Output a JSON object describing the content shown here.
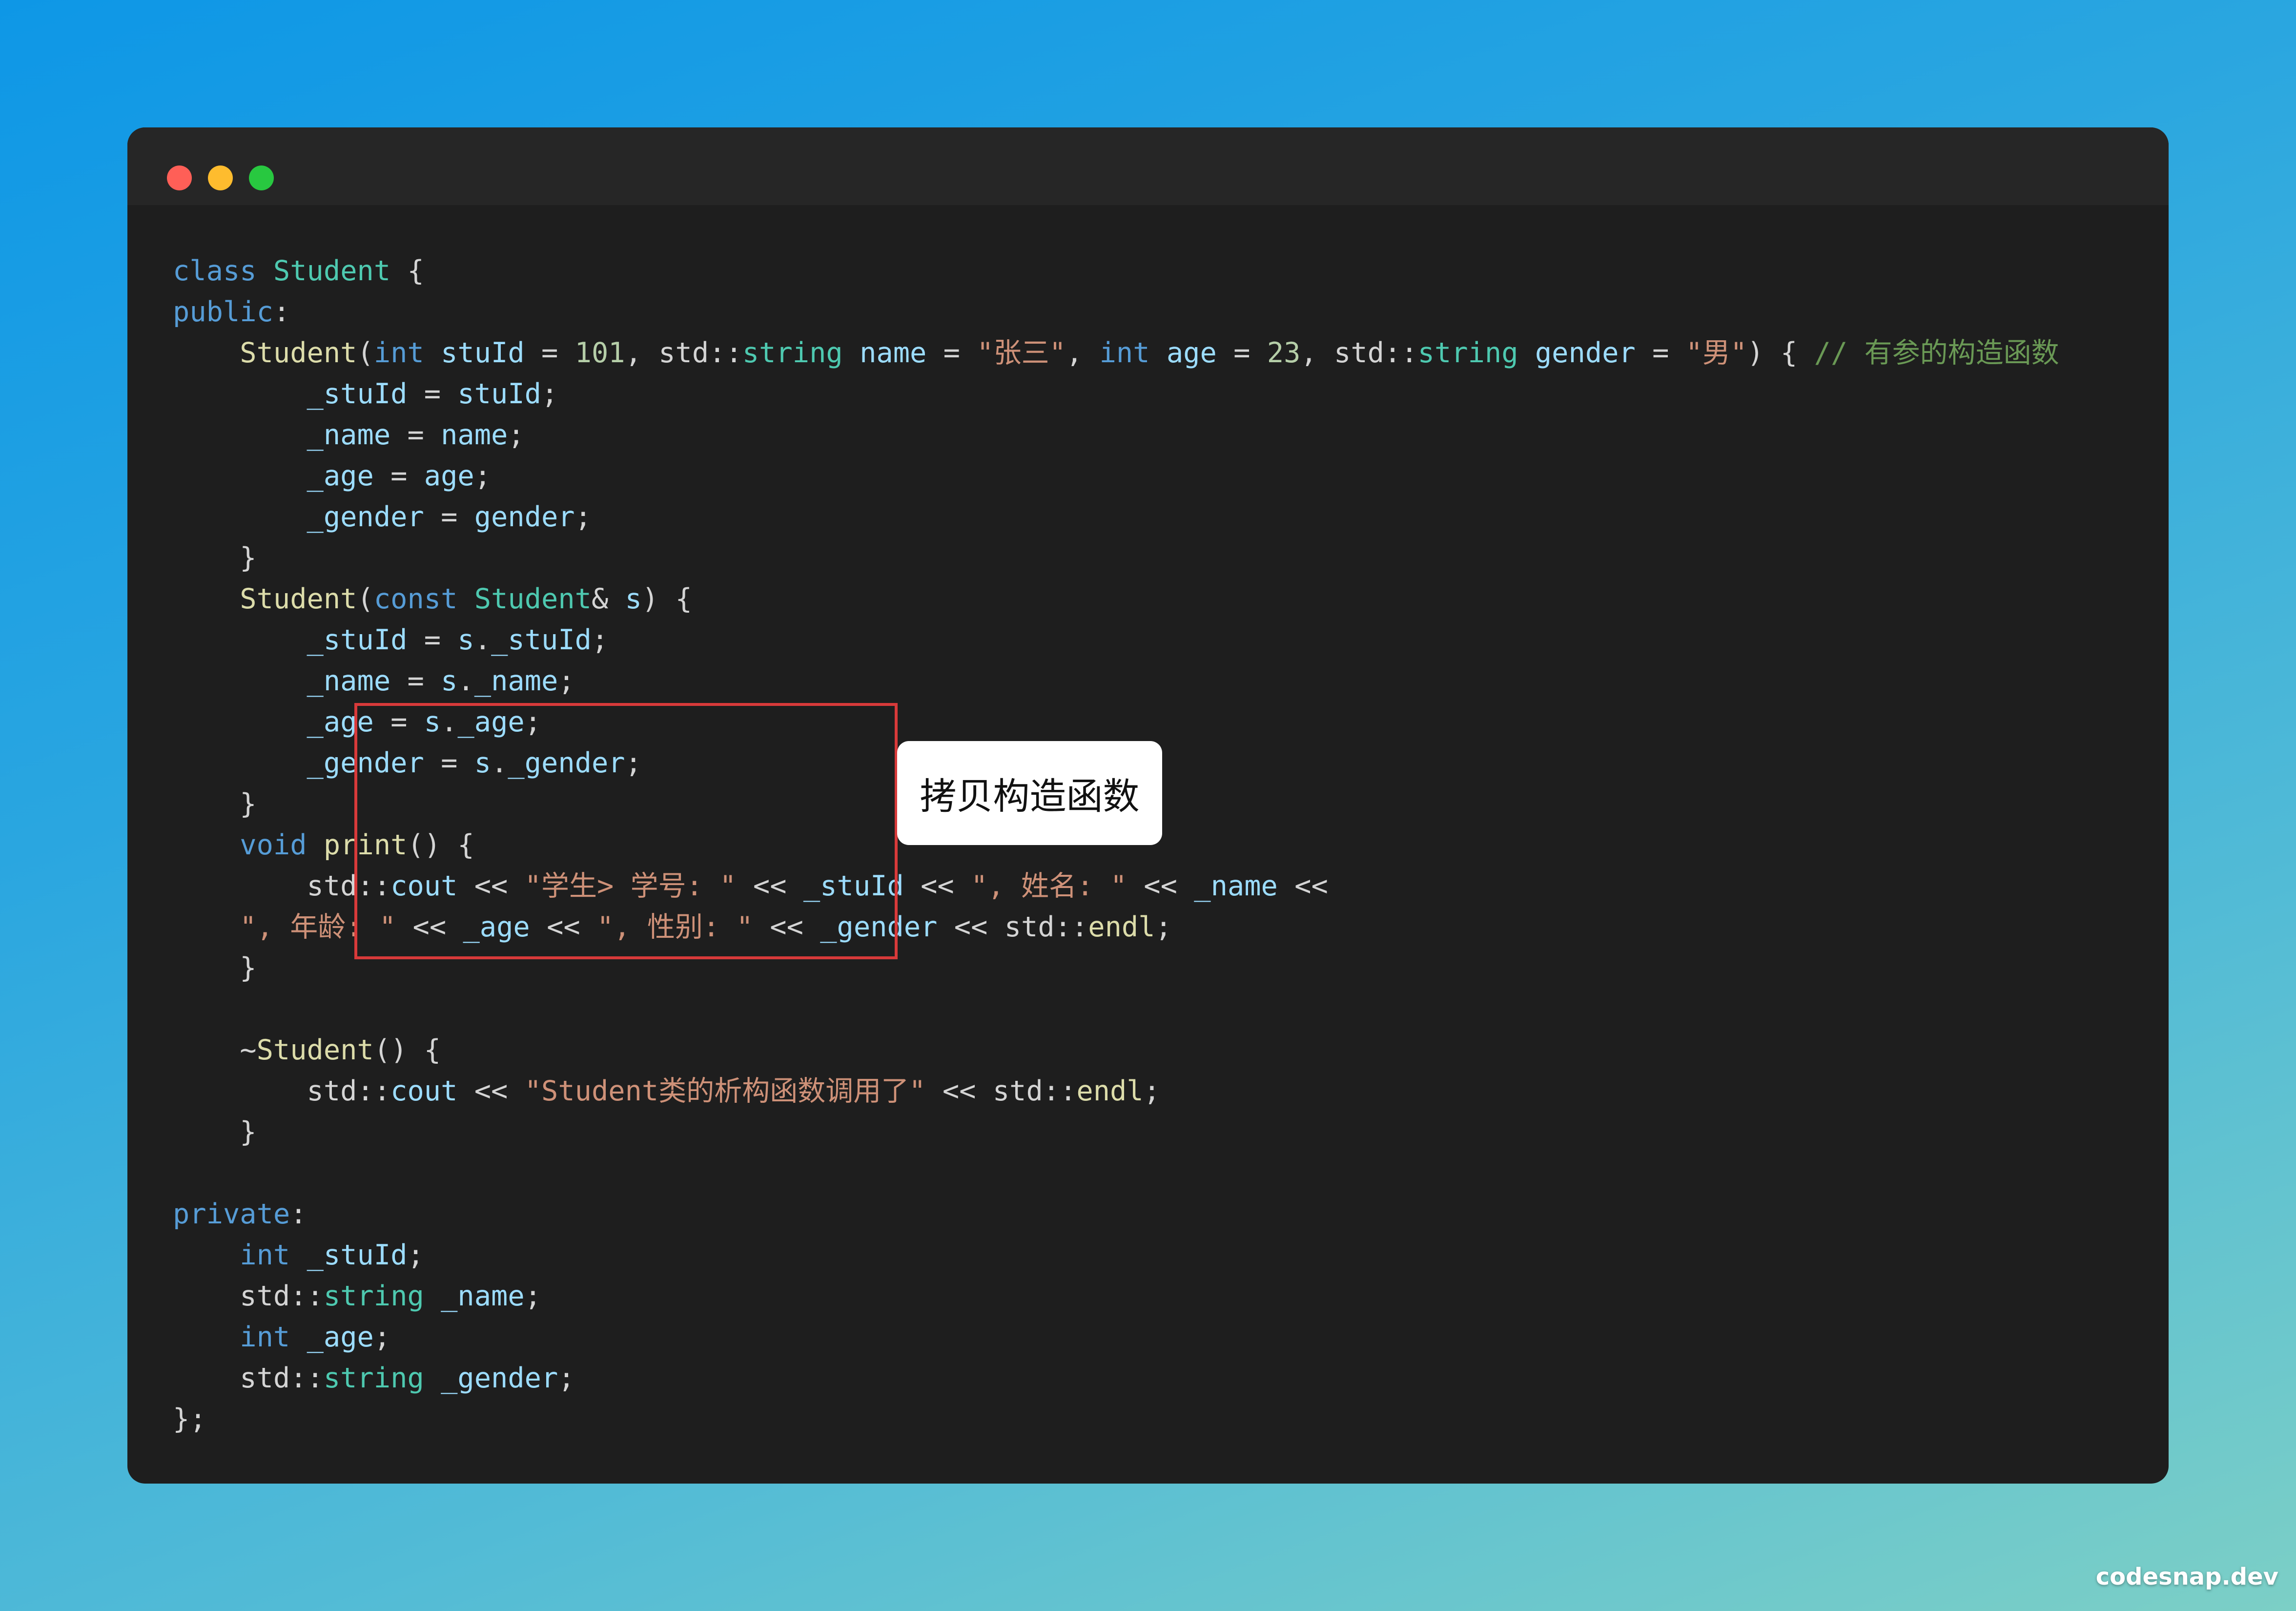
{
  "window": {
    "traffic_lights": [
      "red",
      "yellow",
      "green"
    ],
    "colors": {
      "red": "#ff5f57",
      "yellow": "#febc2e",
      "green": "#28c840"
    }
  },
  "code": {
    "language": "cpp",
    "lines": [
      [
        [
          "kw",
          "class"
        ],
        [
          "pl",
          " "
        ],
        [
          "ty",
          "Student"
        ],
        [
          "pl",
          " {"
        ]
      ],
      [
        [
          "kw",
          "public"
        ],
        [
          "pl",
          ":"
        ]
      ],
      [
        [
          "pl",
          "    "
        ],
        [
          "fn",
          "Student"
        ],
        [
          "pl",
          "("
        ],
        [
          "kw",
          "int"
        ],
        [
          "pl",
          " "
        ],
        [
          "var",
          "stuId"
        ],
        [
          "pl",
          " = "
        ],
        [
          "num",
          "101"
        ],
        [
          "pl",
          ", std::"
        ],
        [
          "ty",
          "string"
        ],
        [
          "pl",
          " "
        ],
        [
          "var",
          "name"
        ],
        [
          "pl",
          " = "
        ],
        [
          "str",
          "\"张三\""
        ],
        [
          "pl",
          ", "
        ],
        [
          "kw",
          "int"
        ],
        [
          "pl",
          " "
        ],
        [
          "var",
          "age"
        ],
        [
          "pl",
          " = "
        ],
        [
          "num",
          "23"
        ],
        [
          "pl",
          ", std::"
        ],
        [
          "ty",
          "string"
        ],
        [
          "pl",
          " "
        ],
        [
          "var",
          "gender"
        ],
        [
          "pl",
          " = "
        ],
        [
          "str",
          "\"男\""
        ],
        [
          "pl",
          ") { "
        ],
        [
          "cm",
          "// 有参的构造函数"
        ]
      ],
      [
        [
          "pl",
          "        "
        ],
        [
          "var",
          "_stuId"
        ],
        [
          "pl",
          " = "
        ],
        [
          "var",
          "stuId"
        ],
        [
          "pl",
          ";"
        ]
      ],
      [
        [
          "pl",
          "        "
        ],
        [
          "var",
          "_name"
        ],
        [
          "pl",
          " = "
        ],
        [
          "var",
          "name"
        ],
        [
          "pl",
          ";"
        ]
      ],
      [
        [
          "pl",
          "        "
        ],
        [
          "var",
          "_age"
        ],
        [
          "pl",
          " = "
        ],
        [
          "var",
          "age"
        ],
        [
          "pl",
          ";"
        ]
      ],
      [
        [
          "pl",
          "        "
        ],
        [
          "var",
          "_gender"
        ],
        [
          "pl",
          " = "
        ],
        [
          "var",
          "gender"
        ],
        [
          "pl",
          ";"
        ]
      ],
      [
        [
          "pl",
          "    }"
        ]
      ],
      [
        [
          "pl",
          "    "
        ],
        [
          "fn",
          "Student"
        ],
        [
          "pl",
          "("
        ],
        [
          "kw",
          "const"
        ],
        [
          "pl",
          " "
        ],
        [
          "ty",
          "Student"
        ],
        [
          "pl",
          "& "
        ],
        [
          "var",
          "s"
        ],
        [
          "pl",
          ") {"
        ]
      ],
      [
        [
          "pl",
          "        "
        ],
        [
          "var",
          "_stuId"
        ],
        [
          "pl",
          " = "
        ],
        [
          "var",
          "s"
        ],
        [
          "pl",
          "."
        ],
        [
          "var",
          "_stuId"
        ],
        [
          "pl",
          ";"
        ]
      ],
      [
        [
          "pl",
          "        "
        ],
        [
          "var",
          "_name"
        ],
        [
          "pl",
          " = "
        ],
        [
          "var",
          "s"
        ],
        [
          "pl",
          "."
        ],
        [
          "var",
          "_name"
        ],
        [
          "pl",
          ";"
        ]
      ],
      [
        [
          "pl",
          "        "
        ],
        [
          "var",
          "_age"
        ],
        [
          "pl",
          " = "
        ],
        [
          "var",
          "s"
        ],
        [
          "pl",
          "."
        ],
        [
          "var",
          "_age"
        ],
        [
          "pl",
          ";"
        ]
      ],
      [
        [
          "pl",
          "        "
        ],
        [
          "var",
          "_gender"
        ],
        [
          "pl",
          " = "
        ],
        [
          "var",
          "s"
        ],
        [
          "pl",
          "."
        ],
        [
          "var",
          "_gender"
        ],
        [
          "pl",
          ";"
        ]
      ],
      [
        [
          "pl",
          "    }"
        ]
      ],
      [
        [
          "pl",
          "    "
        ],
        [
          "kw",
          "void"
        ],
        [
          "pl",
          " "
        ],
        [
          "fn",
          "print"
        ],
        [
          "pl",
          "() {"
        ]
      ],
      [
        [
          "pl",
          "        std::"
        ],
        [
          "var",
          "cout"
        ],
        [
          "pl",
          " << "
        ],
        [
          "str",
          "\"学生> 学号: \""
        ],
        [
          "pl",
          " << "
        ],
        [
          "var",
          "_stuId"
        ],
        [
          "pl",
          " << "
        ],
        [
          "str",
          "\", 姓名: \""
        ],
        [
          "pl",
          " << "
        ],
        [
          "var",
          "_name"
        ],
        [
          "pl",
          " <<"
        ]
      ],
      [
        [
          "pl",
          "    "
        ],
        [
          "str",
          "\", 年龄: \""
        ],
        [
          "pl",
          " << "
        ],
        [
          "var",
          "_age"
        ],
        [
          "pl",
          " << "
        ],
        [
          "str",
          "\", 性别: \""
        ],
        [
          "pl",
          " << "
        ],
        [
          "var",
          "_gender"
        ],
        [
          "pl",
          " << std::"
        ],
        [
          "fn",
          "endl"
        ],
        [
          "pl",
          ";"
        ]
      ],
      [
        [
          "pl",
          "    }"
        ]
      ],
      [
        [
          "pl",
          ""
        ]
      ],
      [
        [
          "pl",
          "    ~"
        ],
        [
          "fn",
          "Student"
        ],
        [
          "pl",
          "() {"
        ]
      ],
      [
        [
          "pl",
          "        std::"
        ],
        [
          "var",
          "cout"
        ],
        [
          "pl",
          " << "
        ],
        [
          "str",
          "\"Student类的析构函数调用了\""
        ],
        [
          "pl",
          " << std::"
        ],
        [
          "fn",
          "endl"
        ],
        [
          "pl",
          ";"
        ]
      ],
      [
        [
          "pl",
          "    }"
        ]
      ],
      [
        [
          "pl",
          ""
        ]
      ],
      [
        [
          "kw",
          "private"
        ],
        [
          "pl",
          ":"
        ]
      ],
      [
        [
          "pl",
          "    "
        ],
        [
          "kw",
          "int"
        ],
        [
          "pl",
          " "
        ],
        [
          "var",
          "_stuId"
        ],
        [
          "pl",
          ";"
        ]
      ],
      [
        [
          "pl",
          "    std::"
        ],
        [
          "ty",
          "string"
        ],
        [
          "pl",
          " "
        ],
        [
          "var",
          "_name"
        ],
        [
          "pl",
          ";"
        ]
      ],
      [
        [
          "pl",
          "    "
        ],
        [
          "kw",
          "int"
        ],
        [
          "pl",
          " "
        ],
        [
          "var",
          "_age"
        ],
        [
          "pl",
          ";"
        ]
      ],
      [
        [
          "pl",
          "    std::"
        ],
        [
          "ty",
          "string"
        ],
        [
          "pl",
          " "
        ],
        [
          "var",
          "_gender"
        ],
        [
          "pl",
          ";"
        ]
      ],
      [
        [
          "pl",
          "};"
        ]
      ]
    ]
  },
  "annotation": {
    "label": "拷贝构造函数",
    "box_color": "#d83a3a"
  },
  "watermark": "codesnap.dev",
  "colors": {
    "keyword": "#569cd6",
    "type": "#4ec9b0",
    "function": "#dcdcaa",
    "variable": "#9cdcfe",
    "string": "#ce9178",
    "number": "#b5cea8",
    "comment": "#6a9955",
    "plain": "#d4d4d4",
    "editor_background": "#1e1e1e",
    "marker": "#6d4aff"
  }
}
